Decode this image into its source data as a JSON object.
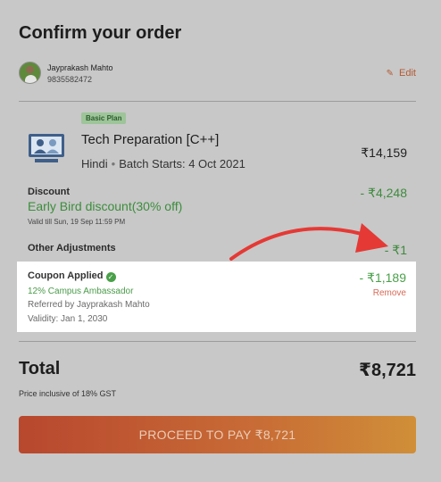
{
  "header": {
    "title": "Confirm your order"
  },
  "user": {
    "name": "Jayprakash Mahto",
    "phone": "9835582472",
    "edit_label": "Edit"
  },
  "course": {
    "plan_badge": "Basic Plan",
    "name": "Tech Preparation [C++]",
    "language": "Hindi",
    "batch": "Batch Starts: 4 Oct 2021",
    "price": "₹14,159"
  },
  "discount": {
    "label": "Discount",
    "name": "Early Bird discount(30% off)",
    "valid_till": "Valid till Sun, 19 Sep 11:59 PM",
    "amount": "- ₹4,248"
  },
  "adjustments": {
    "label": "Other Adjustments",
    "amount": "- ₹1"
  },
  "coupon": {
    "title": "Coupon Applied",
    "code": "12% Campus Ambassador",
    "referred_by": "Referred by Jayprakash Mahto",
    "validity": "Validity: Jan 1, 2030",
    "amount": "- ₹1,189",
    "remove_label": "Remove"
  },
  "total": {
    "label": "Total",
    "amount": "₹8,721",
    "note": "Price inclusive of 18% GST"
  },
  "cta": {
    "label": "PROCEED TO PAY ₹8,721"
  },
  "colors": {
    "accent": "#c0582f",
    "success": "#3f8a3f",
    "danger": "#e03d35",
    "overlay_bg": "#c8c8c8"
  },
  "icons": {
    "edit": "pencil-icon",
    "verified": "check-circle-icon",
    "course": "classroom-icon",
    "annotation": "red-arrow"
  }
}
